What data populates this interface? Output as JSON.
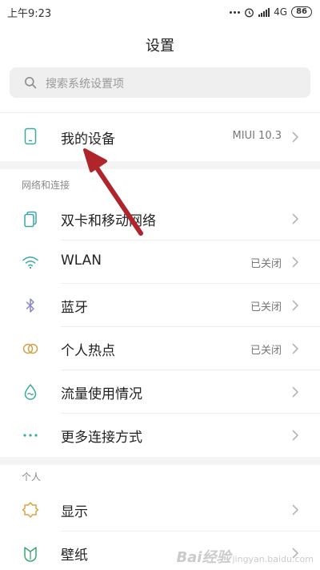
{
  "status_bar": {
    "time": "上午9:23",
    "network": "4G",
    "battery": "86"
  },
  "header": {
    "title": "设置"
  },
  "search": {
    "placeholder": "搜索系统设置项",
    "icon": "search-icon"
  },
  "device": {
    "label": "我的设备",
    "value": "MIUI 10.3",
    "icon": "phone-icon"
  },
  "network_section": {
    "header": "网络和连接",
    "items": [
      {
        "label": "双卡和移动网络",
        "value": "",
        "icon": "sim-icon"
      },
      {
        "label": "WLAN",
        "value": "已关闭",
        "icon": "wifi-icon"
      },
      {
        "label": "蓝牙",
        "value": "已关闭",
        "icon": "bluetooth-icon"
      },
      {
        "label": "个人热点",
        "value": "已关闭",
        "icon": "hotspot-icon"
      },
      {
        "label": "流量使用情况",
        "value": "",
        "icon": "data-drop-icon"
      },
      {
        "label": "更多连接方式",
        "value": "",
        "icon": "more-dots-icon"
      }
    ]
  },
  "personal_section": {
    "header": "个人",
    "items": [
      {
        "label": "显示",
        "value": "",
        "icon": "display-sun-icon"
      },
      {
        "label": "壁纸",
        "value": "",
        "icon": "wallpaper-icon"
      }
    ]
  },
  "watermark": {
    "brand": "Bai",
    "brand2": "经验",
    "sub": "jingyan.baidu.com"
  },
  "colors": {
    "accent_teal": "#3aa8a4",
    "bluetooth_purple": "#8a88c4",
    "hotspot_orange": "#d4a14a",
    "display_orange": "#e0a040",
    "wallpaper_green": "#3aa870",
    "annotation_arrow": "#b0242c"
  }
}
